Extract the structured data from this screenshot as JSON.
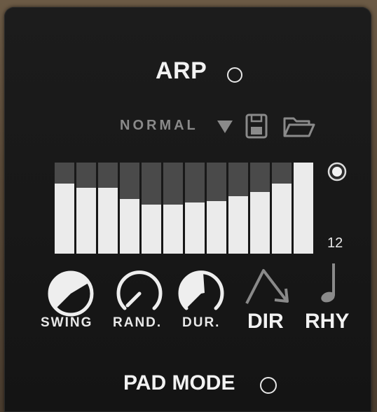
{
  "arp": {
    "title": "ARP",
    "preset_name": "NORMAL",
    "steps": 12,
    "step_levels": [
      0.77,
      0.72,
      0.72,
      0.6,
      0.54,
      0.54,
      0.56,
      0.58,
      0.63,
      0.68,
      0.77,
      1.0
    ],
    "controls": {
      "swing_label": "SWING",
      "rand_label": "RAND.",
      "dur_label": "DUR.",
      "dir_label": "DIR",
      "rhy_label": "RHY"
    },
    "pad_mode_label": "PAD MODE"
  },
  "icons": [
    "dropdown-arrow-icon",
    "save-icon",
    "folder-icon",
    "radio-icon",
    "direction-icon",
    "quarter-note-icon"
  ],
  "colors": {
    "panel": "#181818",
    "bar_fill": "#ebebeb",
    "bar_bg": "#4a4a4a",
    "text": "#f2f2f2",
    "muted": "#8a8a8a"
  }
}
